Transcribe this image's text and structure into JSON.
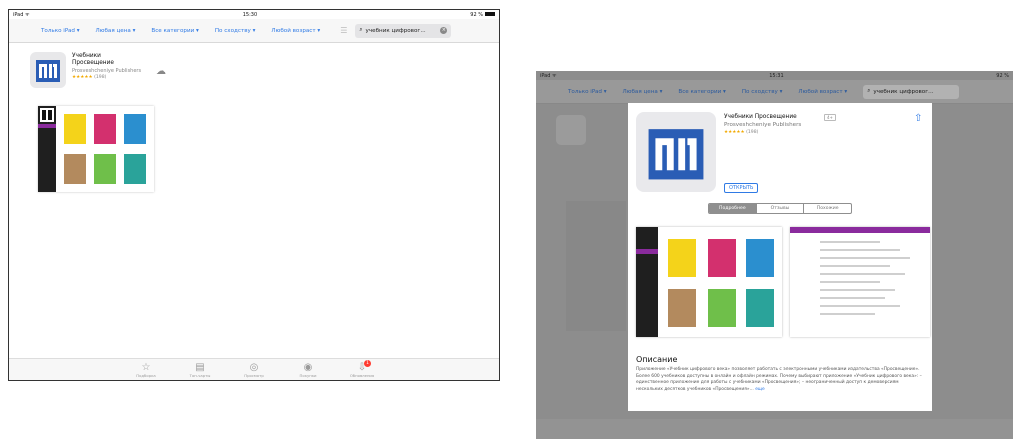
{
  "left": {
    "status": {
      "device": "iPad ᯤ",
      "time": "15:30",
      "battery": "92 %"
    },
    "filters": [
      "Только iPad ▾",
      "Любая цена ▾",
      "Все категории ▾",
      "По сходству ▾",
      "Любой возраст ▾"
    ],
    "search_value": "учебник цифровог...",
    "app": {
      "name_line1": "Учебники",
      "name_line2": "Просвещение",
      "developer": "Prosveshcheniye Publishers",
      "stars": "★★★★★",
      "rating_count": "(198)"
    },
    "tabbar": [
      {
        "icon": "☆",
        "label": "Подборка"
      },
      {
        "icon": "▤",
        "label": "Топ-чарты"
      },
      {
        "icon": "◎",
        "label": "Просмотр"
      },
      {
        "icon": "◉",
        "label": "Покупки"
      },
      {
        "icon": "⇩",
        "label": "Обновления",
        "badge": "1"
      }
    ]
  },
  "right": {
    "status": {
      "device": "iPad ᯤ",
      "time": "15:31",
      "battery": "92 %"
    },
    "filters": [
      "Только iPad ▾",
      "Любая цена ▾",
      "Все категории ▾",
      "По сходству ▾",
      "Любой возраст ▾"
    ],
    "search_value": "учебник цифровог...",
    "modal": {
      "name": "Учебники Просвещение",
      "developer": "Prosveshcheniye Publishers",
      "stars": "★★★★★",
      "rating_count": "(198)",
      "age": "4+",
      "open_label": "ОТКРЫТЬ",
      "segments": [
        "Подробнее",
        "Отзывы",
        "Похожие"
      ],
      "description_title": "Описание",
      "description": "Приложение «Учебник цифрового века» позволяет работать с электронными учебниками издательства «Просвещение». Более 600 учебников доступны в онлайн и офлайн режимах. Почему выбирают приложение «Учебник цифрового века»: – единственное приложение для работы с учебниками «Просвещения»; – неограниченный доступ к демоверсиям нескольких десятков учебников «Просвещения»...",
      "more": "еще"
    }
  }
}
